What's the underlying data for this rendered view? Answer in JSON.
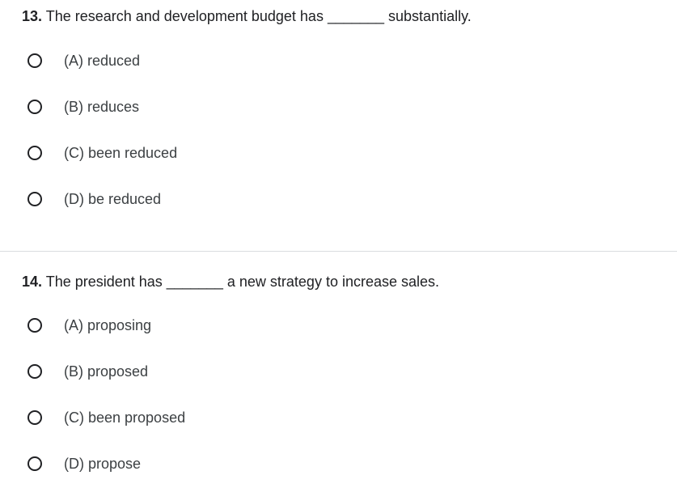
{
  "questions": [
    {
      "number": "13.",
      "text_before": " The research and development budget has ",
      "blank": "_______",
      "text_after": " substantially.",
      "options": [
        {
          "label": "(A) reduced"
        },
        {
          "label": "(B) reduces"
        },
        {
          "label": "(C) been reduced"
        },
        {
          "label": "(D) be reduced"
        }
      ]
    },
    {
      "number": "14.",
      "text_before": " The president has ",
      "blank": "_______",
      "text_after": " a new strategy to increase sales.",
      "options": [
        {
          "label": "(A) proposing"
        },
        {
          "label": "(B) proposed"
        },
        {
          "label": "(C) been proposed"
        },
        {
          "label": "(D) propose"
        }
      ]
    }
  ]
}
